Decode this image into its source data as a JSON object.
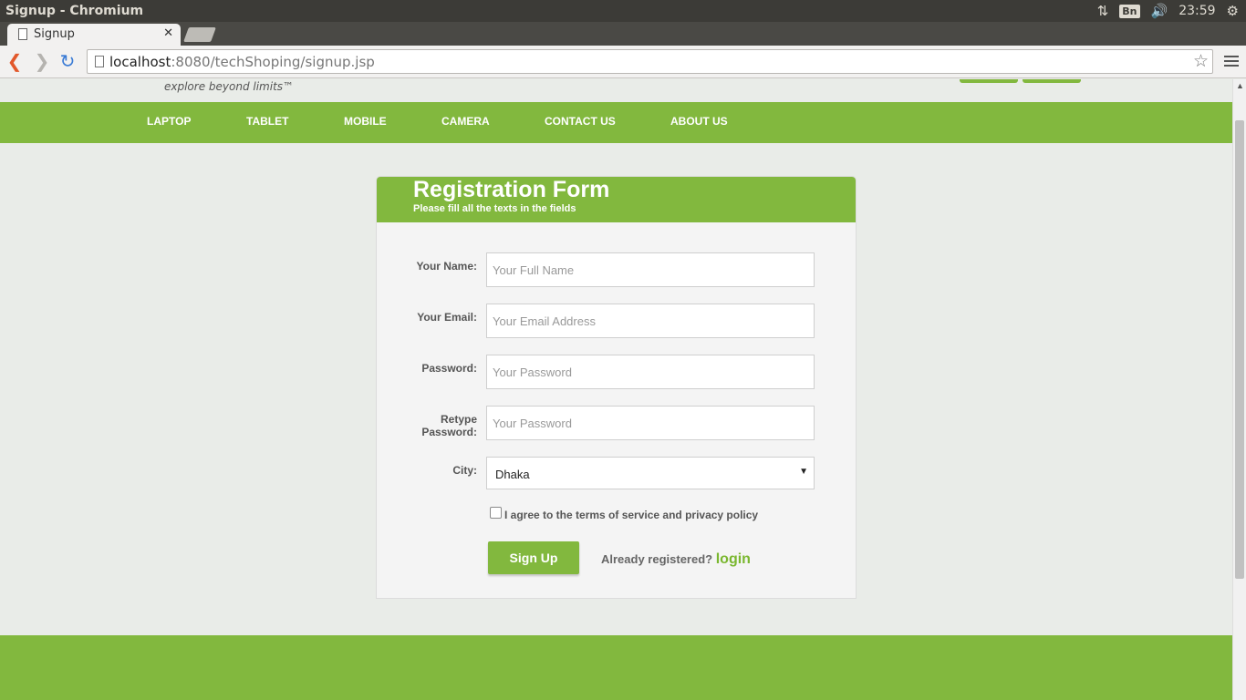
{
  "os": {
    "window_title": "Signup - Chromium",
    "keyboard_layout": "Bn",
    "clock": "23:59"
  },
  "browser": {
    "tab_title": "Signup",
    "url_host": "localhost",
    "url_rest": ":8080/techShoping/signup.jsp"
  },
  "site": {
    "tagline": "explore beyond limits™",
    "nav": [
      "LAPTOP",
      "TABLET",
      "MOBILE",
      "CAMERA",
      "CONTACT US",
      "ABOUT US"
    ]
  },
  "form": {
    "title": "Registration Form",
    "subtitle": "Please fill all the texts in the fields",
    "fields": [
      {
        "label": "Your Name:",
        "placeholder": "Your Full Name"
      },
      {
        "label": "Your Email:",
        "placeholder": "Your Email Address"
      },
      {
        "label": "Password:",
        "placeholder": "Your Password"
      },
      {
        "label": "Retype Password:",
        "placeholder": "Your Password"
      }
    ],
    "city": {
      "label": "City:",
      "selected": "Dhaka"
    },
    "agree_text": "I agree to the terms of service and privacy policy",
    "agree_checked": false,
    "submit_label": "Sign Up",
    "already_text": "Already registered?",
    "login_label": "login"
  },
  "colors": {
    "accent": "#82b83e",
    "page_bg": "#e9ece8"
  }
}
